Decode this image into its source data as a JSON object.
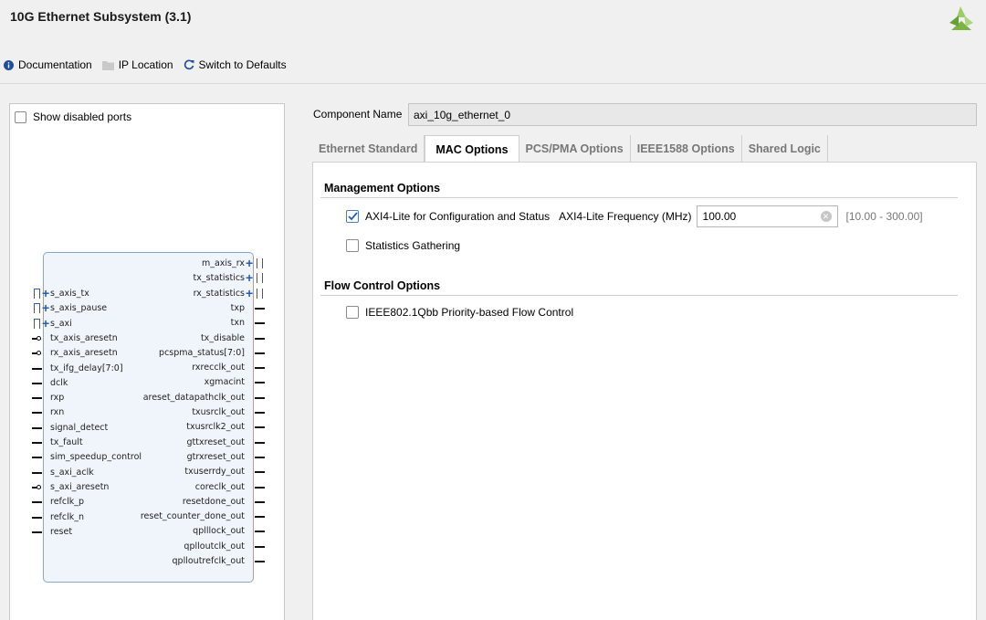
{
  "title": "10G Ethernet Subsystem (3.1)",
  "toolbar": {
    "documentation": "Documentation",
    "ip_location": "IP Location",
    "switch_defaults": "Switch to Defaults"
  },
  "left": {
    "show_disabled": "Show disabled ports",
    "left_pins": [
      "s_axis_tx",
      "s_axis_pause",
      "s_axi",
      "tx_axis_aresetn",
      "rx_axis_aresetn",
      "tx_ifg_delay[7:0]",
      "dclk",
      "rxp",
      "rxn",
      "signal_detect",
      "tx_fault",
      "sim_speedup_control",
      "s_axi_aclk",
      "s_axi_aresetn",
      "refclk_p",
      "refclk_n",
      "reset"
    ],
    "right_pins": [
      "m_axis_rx",
      "tx_statistics",
      "rx_statistics",
      "txp",
      "txn",
      "tx_disable",
      "pcspma_status[7:0]",
      "rxrecclk_out",
      "xgmacint",
      "areset_datapathclk_out",
      "txusrclk_out",
      "txusrclk2_out",
      "gttxreset_out",
      "gtrxreset_out",
      "txuserrdy_out",
      "coreclk_out",
      "resetdone_out",
      "reset_counter_done_out",
      "qplllock_out",
      "qplloutclk_out",
      "qplloutrefclk_out"
    ]
  },
  "component": {
    "label": "Component Name",
    "value": "axi_10g_ethernet_0"
  },
  "tabs": [
    "Ethernet Standard",
    "MAC Options",
    "PCS/PMA Options",
    "IEEE1588 Options",
    "Shared Logic"
  ],
  "active_tab": "MAC Options",
  "management": {
    "title": "Management Options",
    "axi_lite": {
      "label": "AXI4-Lite for Configuration and Status",
      "checked": true
    },
    "freq_label": "AXI4-Lite Frequency (MHz)",
    "freq_value": "100.00",
    "freq_range": "[10.00 - 300.00]",
    "stats": {
      "label": "Statistics Gathering",
      "checked": false
    }
  },
  "flow": {
    "title": "Flow Control Options",
    "pfc": {
      "label": "IEEE802.1Qbb Priority-based Flow Control",
      "checked": false
    }
  },
  "colors": {
    "accent": "#2a5db0",
    "logo": "#7cb342"
  }
}
